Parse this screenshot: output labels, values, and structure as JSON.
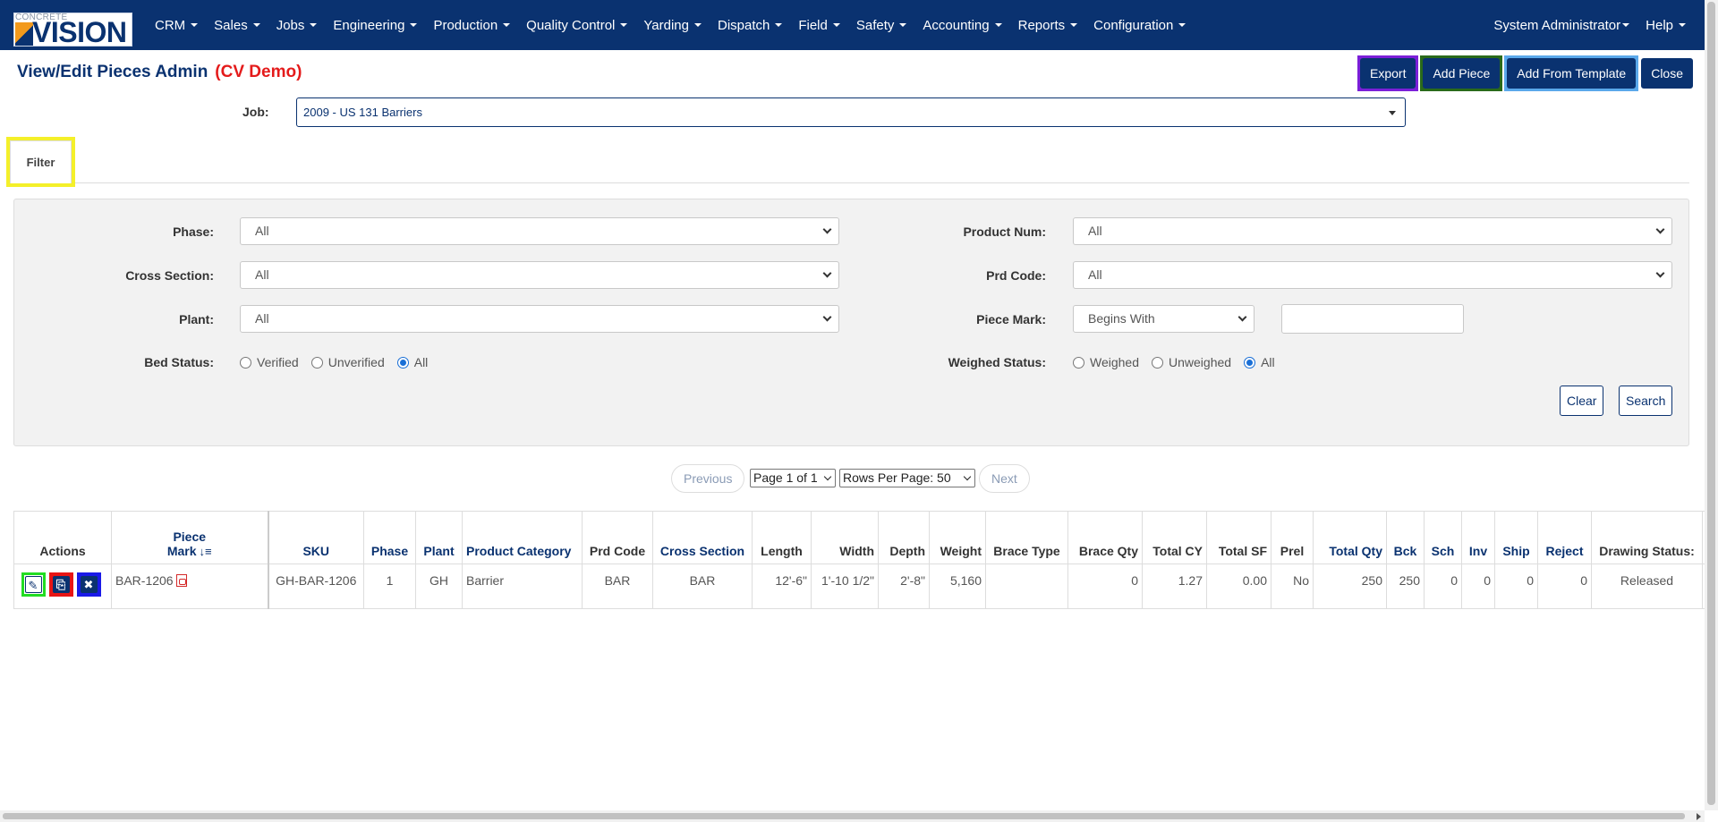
{
  "app": {
    "logo_top": "CONCRETE",
    "logo_main": "VISION"
  },
  "nav": {
    "items": [
      "CRM",
      "Sales",
      "Jobs",
      "Engineering",
      "Production",
      "Quality Control",
      "Yarding",
      "Dispatch",
      "Field",
      "Safety",
      "Accounting",
      "Reports",
      "Configuration"
    ],
    "user": "System Administrator",
    "help": "Help"
  },
  "page": {
    "title": "View/Edit Pieces Admin",
    "env": "(CV Demo)"
  },
  "actions": {
    "export": "Export",
    "add_piece": "Add Piece",
    "add_from_template": "Add From Template",
    "close": "Close"
  },
  "job": {
    "label": "Job:",
    "value": "2009 - US 131 Barriers"
  },
  "tabs": {
    "filter": "Filter"
  },
  "filters": {
    "phase": {
      "label": "Phase:",
      "value": "All"
    },
    "cross_section": {
      "label": "Cross Section:",
      "value": "All"
    },
    "plant": {
      "label": "Plant:",
      "value": "All"
    },
    "bed_status": {
      "label": "Bed Status:",
      "options": [
        "Verified",
        "Unverified",
        "All"
      ],
      "selected": "All"
    },
    "product_num": {
      "label": "Product Num:",
      "value": "All"
    },
    "prd_code": {
      "label": "Prd Code:",
      "value": "All"
    },
    "piece_mark": {
      "label": "Piece Mark:",
      "mode": "Begins With",
      "value": ""
    },
    "weighed_status": {
      "label": "Weighed Status:",
      "options": [
        "Weighed",
        "Unweighed",
        "All"
      ],
      "selected": "All"
    },
    "clear": "Clear",
    "search": "Search"
  },
  "pagination": {
    "previous": "Previous",
    "page": "Page 1 of 1",
    "rows_per_page": "Rows Per Page: 50",
    "next": "Next"
  },
  "table": {
    "headers": {
      "actions": "Actions",
      "piece_mark_1": "Piece",
      "piece_mark_2": "Mark",
      "sku": "SKU",
      "phase": "Phase",
      "plant": "Plant",
      "product_category": "Product Category",
      "prd_code": "Prd Code",
      "cross_section": "Cross Section",
      "length": "Length",
      "width": "Width",
      "depth": "Depth",
      "weight": "Weight",
      "brace_type": "Brace Type",
      "brace_qty": "Brace Qty",
      "total_cy": "Total CY",
      "total_sf": "Total SF",
      "prel": "Prel",
      "total_qty": "Total Qty",
      "bck": "Bck",
      "sch": "Sch",
      "inv": "Inv",
      "ship": "Ship",
      "reject": "Reject",
      "drawing_status": "Drawing Status:"
    },
    "rows": [
      {
        "piece_mark": "BAR-1206",
        "sku": "GH-BAR-1206",
        "phase": "1",
        "plant": "GH",
        "product_category": "Barrier",
        "prd_code": "BAR",
        "cross_section": "BAR",
        "length": "12'-6\"",
        "width": "1'-10 1/2\"",
        "depth": "2'-8\"",
        "weight": "5,160",
        "brace_type": "",
        "brace_qty": "0",
        "total_cy": "1.27",
        "total_sf": "0.00",
        "prel": "No",
        "total_qty": "250",
        "bck": "250",
        "sch": "0",
        "inv": "0",
        "ship": "0",
        "reject": "0",
        "drawing_status": "Released"
      }
    ]
  }
}
